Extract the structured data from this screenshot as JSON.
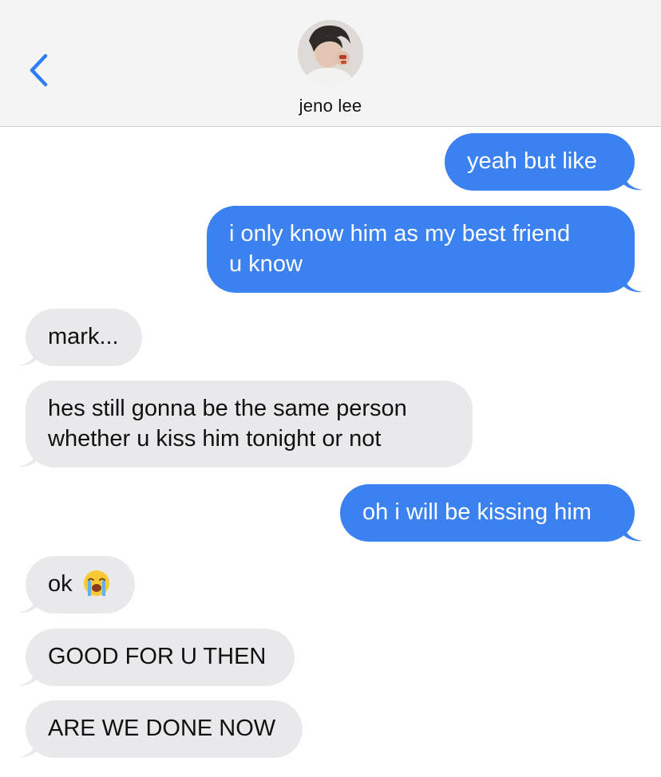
{
  "header": {
    "back_icon": "chevron-left-icon",
    "contact_name": "jeno lee",
    "avatar_icon": "contact-photo"
  },
  "colors": {
    "outgoing_bubble": "#3b82f0",
    "incoming_bubble": "#e9e9eb",
    "accent": "#2f7cf6"
  },
  "messages": [
    {
      "direction": "outgoing",
      "text": "yeah but like"
    },
    {
      "direction": "outgoing",
      "lines": [
        "i only know him as my best friend",
        "u know"
      ]
    },
    {
      "direction": "incoming",
      "text": "mark..."
    },
    {
      "direction": "incoming",
      "lines": [
        "hes still gonna be the same person",
        "whether u kiss him tonight or not"
      ]
    },
    {
      "direction": "outgoing",
      "text": "oh i will be kissing him"
    },
    {
      "direction": "incoming",
      "text": "ok",
      "emoji": "loudly-crying-face-emoji"
    },
    {
      "direction": "incoming",
      "text": "GOOD FOR U THEN"
    },
    {
      "direction": "incoming",
      "text": "ARE WE DONE NOW"
    }
  ]
}
